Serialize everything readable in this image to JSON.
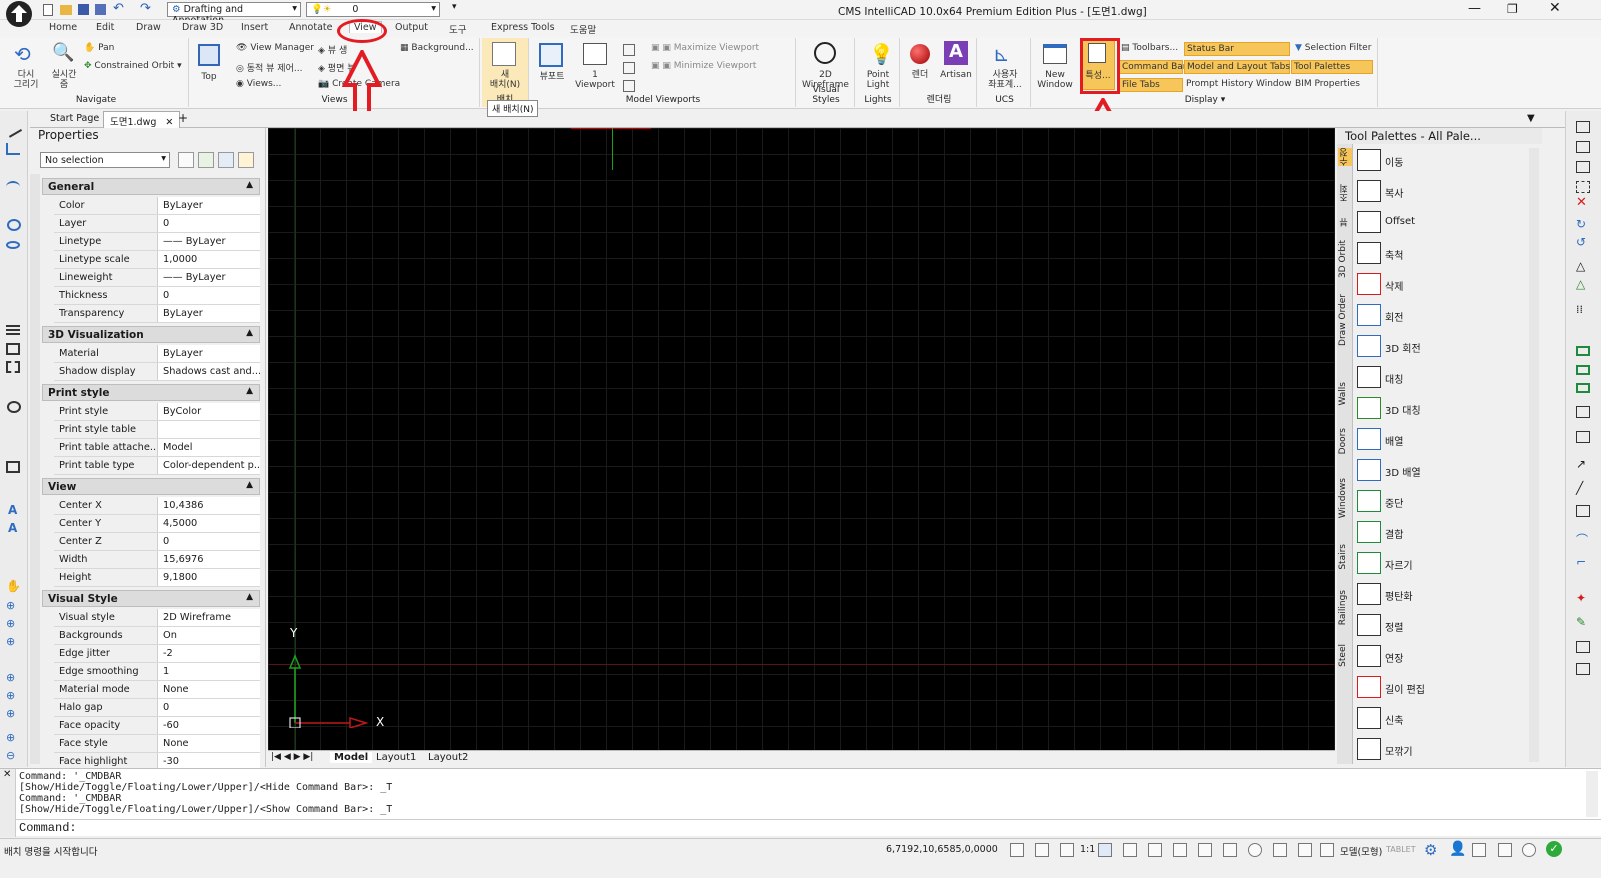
{
  "qat": {
    "workspace": "Drafting and Annotation",
    "layer": "0"
  },
  "title": "CMS IntelliCAD 10.0x64 Premium Edition Plus  - [도면1.dwg]",
  "ribbon_tabs": [
    "Home",
    "Edit",
    "Draw",
    "Draw 3D",
    "Insert",
    "Annotate",
    "View",
    "Output",
    "도구",
    "Express Tools",
    "도움말"
  ],
  "ribbon": {
    "navigate": {
      "title": "Navigate",
      "redraw": "다시\n그리기",
      "realtime": "실시간\n줌",
      "pan": "Pan",
      "orbit": "Constrained Orbit"
    },
    "views": {
      "title": "Views",
      "top": "Top",
      "view_manager": "View Manager",
      "dynamic": "동적 뷰 제어...",
      "views": "Views...",
      "bview": "뷰 생",
      "planview": "평면 뷰",
      "camera": "Create Camera",
      "background": "Background..."
    },
    "layout": {
      "title": "배치",
      "new_layout": "새\n배치(N)",
      "tooltip": "새 배치(N)"
    },
    "model_viewports": {
      "title": "Model Viewports",
      "viewport_tool": "뷰포트",
      "one_vp": "1\nViewport",
      "max": "Maximize Viewport",
      "min": "Minimize Viewport"
    },
    "visual_styles": {
      "title": "Visual Styles",
      "wire": "2D\nWireframe"
    },
    "lights": {
      "title": "Lights",
      "point": "Point\nLight"
    },
    "render": {
      "title": "렌더링",
      "render": "렌더",
      "artisan": "Artisan"
    },
    "ucs": {
      "title": "UCS",
      "user": "사용자\n좌표계..."
    },
    "display": {
      "title": "Display",
      "new_window": "New\nWindow",
      "props": "특성...",
      "toolbars": "Toolbars...",
      "command_bar": "Command Bar",
      "file_tabs": "File Tabs",
      "status_bar": "Status Bar",
      "model_layout_tabs": "Model and Layout Tabs",
      "prompt_history": "Prompt History Window",
      "selection_filter": "Selection Filter",
      "tool_palettes": "Tool Palettes",
      "bim_properties": "BIM Properties"
    }
  },
  "doc_tabs": [
    "Start Page",
    "도면1.dwg"
  ],
  "properties": {
    "title": "Properties",
    "selection": "No selection",
    "sections": [
      {
        "name": "General",
        "rows": [
          [
            "Color",
            "ByLayer"
          ],
          [
            "Layer",
            "0"
          ],
          [
            "Linetype",
            "—— ByLayer"
          ],
          [
            "Linetype scale",
            "1,0000"
          ],
          [
            "Lineweight",
            "—— ByLayer"
          ],
          [
            "Thickness",
            "0"
          ],
          [
            "Transparency",
            "ByLayer"
          ]
        ]
      },
      {
        "name": "3D Visualization",
        "rows": [
          [
            "Material",
            "ByLayer"
          ],
          [
            "Shadow display",
            "Shadows cast and..."
          ]
        ]
      },
      {
        "name": "Print style",
        "rows": [
          [
            "Print style",
            "ByColor"
          ],
          [
            "Print style table",
            ""
          ],
          [
            "Print table attache...",
            "Model"
          ],
          [
            "Print table type",
            "Color-dependent p..."
          ]
        ]
      },
      {
        "name": "View",
        "rows": [
          [
            "Center X",
            "10,4386"
          ],
          [
            "Center Y",
            "4,5000"
          ],
          [
            "Center Z",
            "0"
          ],
          [
            "Width",
            "15,6976"
          ],
          [
            "Height",
            "9,1800"
          ]
        ]
      },
      {
        "name": "Visual Style",
        "rows": [
          [
            "Visual style",
            "2D Wireframe"
          ],
          [
            "Backgrounds",
            "On"
          ],
          [
            "Edge jitter",
            "-2"
          ],
          [
            "Edge smoothing",
            "1"
          ],
          [
            "Material mode",
            "None"
          ],
          [
            "Halo gap",
            "0"
          ],
          [
            "Face opacity",
            "-60"
          ],
          [
            "Face style",
            "None"
          ],
          [
            "Face highlight",
            "-30"
          ]
        ]
      }
    ]
  },
  "layout_tabs": [
    "Model",
    "Layout1",
    "Layout2"
  ],
  "axis": {
    "x": "X",
    "y": "Y"
  },
  "palette": {
    "title": "Tool Palettes - All Pale...",
    "vtabs": [
      "수정",
      "조회",
      "뷰",
      "3D Orbit",
      "Draw Order",
      "Walls",
      "Doors",
      "Windows",
      "Stairs",
      "Railings",
      "Steel"
    ],
    "tools": [
      "이동",
      "복사",
      "Offset",
      "축척",
      "삭제",
      "회전",
      "3D 회전",
      "대칭",
      "3D 대칭",
      "배열",
      "3D 배열",
      "중단",
      "결합",
      "자르기",
      "평탄화",
      "정렬",
      "연장",
      "길이 편집",
      "신축",
      "모깎기"
    ]
  },
  "command": {
    "lines": [
      "Command: '_CMDBAR",
      "[Show/Hide/Toggle/Floating/Lower/Upper]/<Hide Command Bar>: _T",
      "Command: '_CMDBAR",
      "[Show/Hide/Toggle/Floating/Lower/Upper]/<Show Command Bar>: _T"
    ],
    "prompt": "Command:"
  },
  "status": {
    "message": "배치 명령을 시작합니다",
    "coords": "6,7192,10,6585,0,0000",
    "scale": "1:1",
    "mode": "모델(모형)",
    "tablet": "TABLET"
  },
  "colors": {
    "accent_red": "#e31b23",
    "highlight": "#f7c65a"
  }
}
